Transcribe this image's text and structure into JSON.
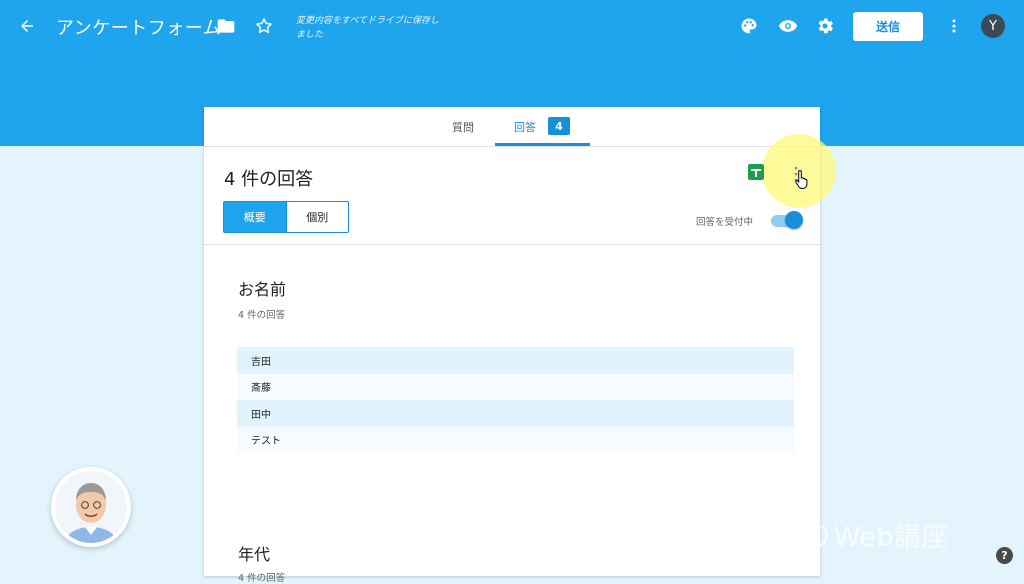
{
  "header": {
    "title": "アンケートフォーム",
    "save_status": "変更内容をすべてドライブに保存しました",
    "send_label": "送信",
    "avatar_initial": "Y",
    "background_color": "#1fa5ee"
  },
  "tabs": {
    "questions_label": "質問",
    "responses_label": "回答",
    "responses_count": "4",
    "active": "responses"
  },
  "summary": {
    "response_count_heading": "4 件の回答",
    "segment_summary": "概要",
    "segment_individual": "個別",
    "accepting_label": "回答を受付中",
    "accepting_on": true
  },
  "questions": [
    {
      "title": "お名前",
      "subtitle": "4 件の回答",
      "answers": [
        "吉田",
        "斎藤",
        "田中",
        "テスト"
      ]
    },
    {
      "title": "年代",
      "subtitle": "4 件の回答"
    }
  ],
  "overlay": {
    "watermark": "ひとりWeb講座",
    "help_label": "?"
  },
  "icons": [
    "back-arrow-icon",
    "folder-icon",
    "star-icon",
    "palette-icon",
    "eye-icon",
    "gear-icon",
    "more-vert-icon",
    "sheets-icon",
    "cursor-icon"
  ]
}
